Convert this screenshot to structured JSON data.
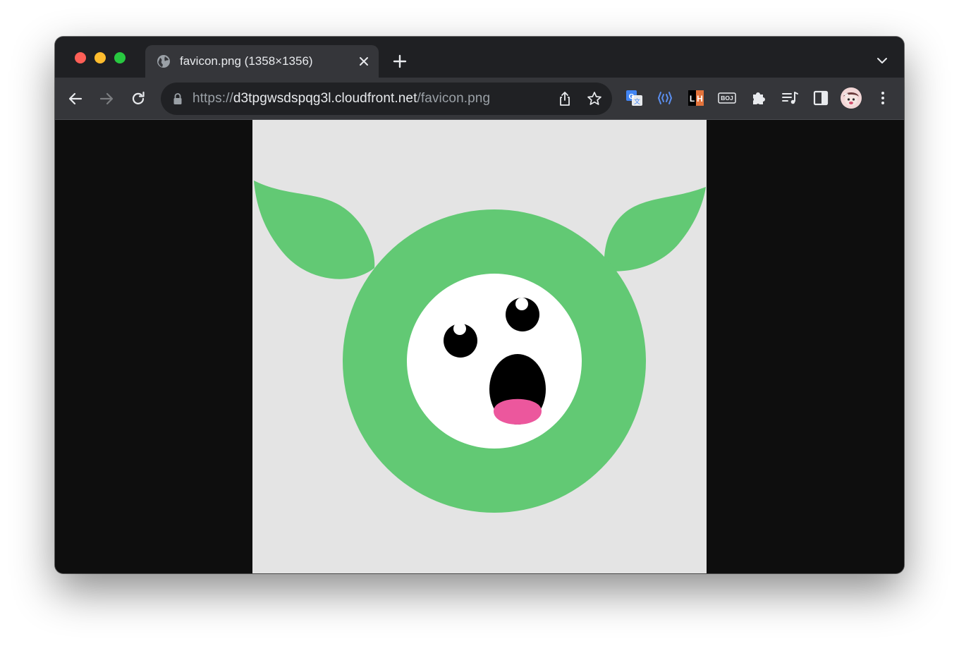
{
  "window": {
    "tab": {
      "title": "favicon.png (1358×1356)",
      "favicon": "globe-icon"
    },
    "controls": {
      "close": "close-icon",
      "new_tab": "plus-icon",
      "tab_search": "chevron-down-icon"
    }
  },
  "toolbar": {
    "back": "arrow-left-icon",
    "forward": "arrow-right-icon",
    "reload": "reload-icon",
    "url": {
      "scheme": "https://",
      "host": "d3tpgwsdspqg3l.cloudfront.net",
      "path": "/favicon.png"
    },
    "omnibox_actions": [
      "share-icon",
      "star-icon"
    ],
    "extensions": [
      "google-translate-icon",
      "readaloud-icon",
      "lighthouse-icon",
      "boj-extension-icon",
      "puzzle-icon",
      "reading-list-icon",
      "side-panel-icon",
      "profile-avatar",
      "kebab-menu-icon"
    ],
    "lighthouse_label": "LH",
    "boj_label": "BOJ"
  },
  "content": {
    "image_alt": "favicon.png",
    "colors": {
      "background": "#e4e4e4",
      "body": "#62c974",
      "face": "#ffffff",
      "eyes": "#000000",
      "tongue": "#ec579d"
    }
  }
}
